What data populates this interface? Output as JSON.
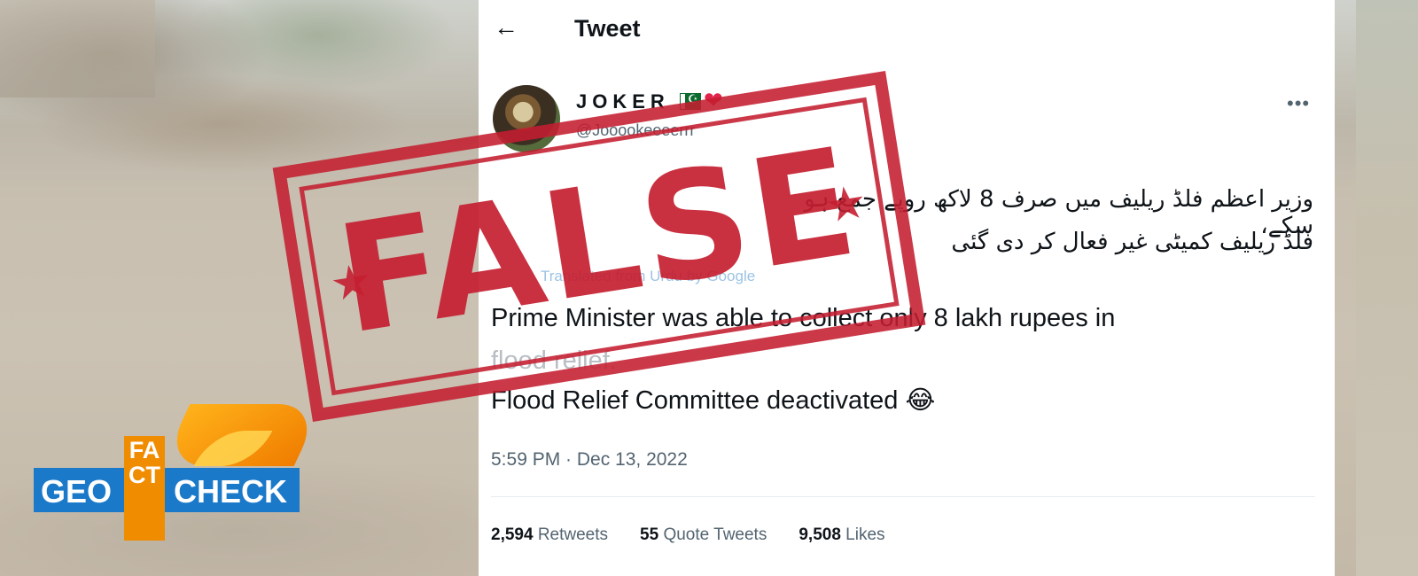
{
  "tweet": {
    "header_title": "Tweet",
    "back_icon": "←",
    "author_name": "JOKER",
    "author_handle": "@Jooookeeeerrr",
    "more_icon": "•••",
    "heart_icon": "❤",
    "urdu_line1": "وزیر اعظم فلڈ ریلیف میں صرف 8 لاکھ روپے جمع ہو سکے،",
    "urdu_line2": "فلڈ ریلیف کمیٹی غیر فعال کر دی گئی",
    "translated_label": "Translated from Urdu by Google",
    "english_line1": "Prime Minister was able to collect only 8 lakh rupees in",
    "english_line2": "flood relief.",
    "english_line3": "Flood Relief Committee deactivated",
    "emoji": "😂",
    "timestamp": "5:59 PM · Dec 13, 2022",
    "stats": [
      {
        "count": "2,594",
        "label": "Retweets"
      },
      {
        "count": "55",
        "label": "Quote Tweets"
      },
      {
        "count": "9,508",
        "label": "Likes"
      }
    ]
  },
  "stamp": {
    "text": "FALSE",
    "color": "#c41e30"
  },
  "logo": {
    "geo": "GEO",
    "fact": "FACT",
    "check": "CHECK",
    "blue": "#1b79c9",
    "orange": "#f08c00"
  }
}
